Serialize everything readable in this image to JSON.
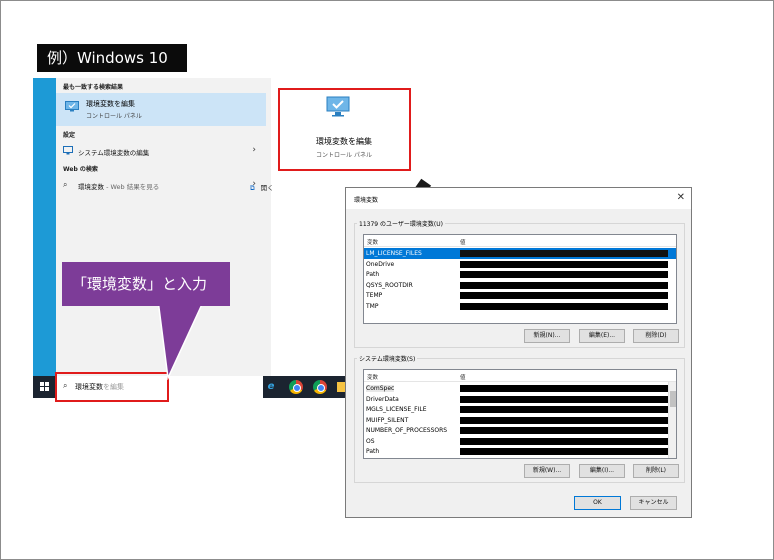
{
  "example_tag": "例）Windows 10",
  "search_pane": {
    "best_match_header": "最も一致する検索結果",
    "best_match": {
      "title": "環境変数を編集",
      "subtitle": "コントロール パネル"
    },
    "settings_header": "設定",
    "settings_item": "システム環境変数の編集",
    "web_header": "Web の検索",
    "web_item_query": "環境変数",
    "web_item_suffix": " - Web 結果を見る",
    "preview_title": "環境変数を編集",
    "preview_subtitle": "コントロール パネル",
    "open_action": "開く"
  },
  "taskbar": {
    "search_value": "環境変数",
    "search_ghost": "を編集"
  },
  "callout": "「環境変数」と入力",
  "dialog": {
    "title": "環境変数",
    "user_group_label": "11379 のユーザー環境変数(U)",
    "user_columns": [
      "変数",
      "値"
    ],
    "user_vars": [
      "LM_LICENSE_FILES",
      "OneDrive",
      "Path",
      "QSYS_ROOTDIR",
      "TEMP",
      "TMP"
    ],
    "user_buttons": [
      "新規(N)...",
      "編集(E)...",
      "削除(D)"
    ],
    "system_group_label": "システム環境変数(S)",
    "system_columns": [
      "変数",
      "値"
    ],
    "system_vars": [
      "ComSpec",
      "DriverData",
      "MGLS_LICENSE_FILE",
      "MUIFP_SILENT",
      "NUMBER_OF_PROCESSORS",
      "OS",
      "Path"
    ],
    "system_buttons": [
      "新規(W)...",
      "編集(I)...",
      "削除(L)"
    ],
    "ok": "OK",
    "cancel": "キャンセル"
  },
  "colors": {
    "accent_blue": "#1d9ad6",
    "highlight": "#e01b1b",
    "callout_purple": "#7d3c98",
    "selection": "#0078d7"
  },
  "icons": {
    "best_match": "monitor-check-icon",
    "settings": "monitor-settings-icon",
    "web": "search-icon",
    "open": "open-window-icon",
    "start": "windows-start-icon",
    "taskbar_apps": [
      "task-view-icon",
      "edge-icon",
      "chrome-icon",
      "chrome-icon",
      "file-explorer-icon"
    ]
  }
}
